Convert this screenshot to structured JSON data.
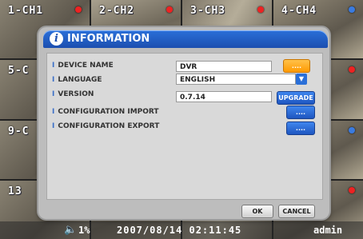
{
  "cameras": [
    {
      "label": "1-CH1",
      "rec": "red"
    },
    {
      "label": "2-CH2",
      "rec": "red"
    },
    {
      "label": "3-CH3",
      "rec": "red"
    },
    {
      "label": "4-CH4",
      "rec": "blue"
    },
    {
      "label": "5-C",
      "rec": "red"
    },
    {
      "label": "",
      "rec": ""
    },
    {
      "label": "",
      "rec": ""
    },
    {
      "label": "",
      "rec": "red"
    },
    {
      "label": "9-C",
      "rec": "blue"
    },
    {
      "label": "",
      "rec": ""
    },
    {
      "label": "",
      "rec": ""
    },
    {
      "label": "",
      "rec": "blue"
    },
    {
      "label": "13",
      "rec": "red"
    },
    {
      "label": "",
      "rec": ""
    },
    {
      "label": "",
      "rec": ""
    },
    {
      "label": "",
      "rec": "red"
    }
  ],
  "dialog": {
    "title": "INFORMATION",
    "rows": {
      "device_name": {
        "label": "DEVICE NAME",
        "value": "DVR"
      },
      "language": {
        "label": "LANGUAGE",
        "value": "ENGLISH"
      },
      "version": {
        "label": "VERSION",
        "value": "0.7.14",
        "button": "UPGRADE"
      },
      "config_import": {
        "label": "CONFIGURATION IMPORT",
        "button": "...."
      },
      "config_export": {
        "label": "CONFIGURATION EXPORT",
        "button": "...."
      }
    },
    "ok": "OK",
    "cancel": "CANCEL"
  },
  "statusbar": {
    "volume": "1%",
    "datetime": "2007/08/14  02:11:45",
    "user": "admin"
  },
  "colors": {
    "accent": "#2a6fd8",
    "orange": "#ff9a00",
    "rec_red": "#e22222",
    "rec_blue": "#3a7be0"
  }
}
